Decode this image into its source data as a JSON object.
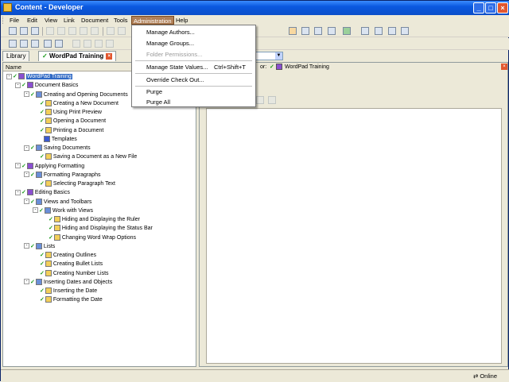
{
  "window": {
    "title": "Content - Developer"
  },
  "menubar": [
    "File",
    "Edit",
    "View",
    "Link",
    "Document",
    "Tools",
    "Administration",
    "Help"
  ],
  "admin_menu": {
    "items": [
      {
        "label": "Manage Authors...",
        "enabled": true,
        "shortcut": ""
      },
      {
        "label": "Manage Groups...",
        "enabled": true,
        "shortcut": ""
      },
      {
        "label": "Folder Permissions...",
        "enabled": false,
        "shortcut": ""
      },
      {
        "label": "Manage State Values...",
        "enabled": true,
        "shortcut": "Ctrl+Shift+T"
      },
      {
        "label": "Override Check Out...",
        "enabled": true,
        "shortcut": ""
      },
      {
        "label": "Purge",
        "enabled": true,
        "shortcut": ""
      },
      {
        "label": "Purge All",
        "enabled": true,
        "shortcut": ""
      }
    ]
  },
  "tabs": {
    "library": "Library",
    "active": "WordPad Training"
  },
  "left_pane": {
    "column_header": "Name"
  },
  "right_pane": {
    "context_label": "or:",
    "context_value": "WordPad Training"
  },
  "tree": [
    {
      "label": "WordPad Training",
      "level": 0,
      "type": "course",
      "expander": "-",
      "checked": true,
      "selected": true
    },
    {
      "label": "Document Basics",
      "level": 1,
      "type": "course",
      "expander": "-",
      "checked": true
    },
    {
      "label": "Creating and Opening Documents",
      "level": 2,
      "type": "module",
      "expander": "-",
      "checked": true
    },
    {
      "label": "Creating a New Document",
      "level": 3,
      "type": "topic",
      "checked": true
    },
    {
      "label": "Using Print Preview",
      "level": 3,
      "type": "topic",
      "checked": true
    },
    {
      "label": "Opening a Document",
      "level": 3,
      "type": "topic",
      "checked": true
    },
    {
      "label": "Printing a Document",
      "level": 3,
      "type": "topic",
      "checked": true
    },
    {
      "label": "Templates",
      "level": 3,
      "type": "doc",
      "checked": false
    },
    {
      "label": "Saving Documents",
      "level": 2,
      "type": "module",
      "expander": "-",
      "checked": true
    },
    {
      "label": "Saving a Document as a New File",
      "level": 3,
      "type": "topic",
      "checked": true
    },
    {
      "label": "Applying Formatting",
      "level": 1,
      "type": "course",
      "expander": "-",
      "checked": true
    },
    {
      "label": "Formatting Paragraphs",
      "level": 2,
      "type": "module",
      "expander": "-",
      "checked": true
    },
    {
      "label": "Selecting Paragraph Text",
      "level": 3,
      "type": "topic",
      "checked": true
    },
    {
      "label": "Editing Basics",
      "level": 1,
      "type": "course",
      "expander": "-",
      "checked": true
    },
    {
      "label": "Views and Toolbars",
      "level": 2,
      "type": "module",
      "expander": "-",
      "checked": true
    },
    {
      "label": "Work with Views",
      "level": 3,
      "type": "module",
      "expander": "-",
      "checked": true
    },
    {
      "label": "Hiding and Displaying the Ruler",
      "level": 4,
      "type": "topic",
      "checked": true
    },
    {
      "label": "Hiding and Displaying the Status Bar",
      "level": 4,
      "type": "topic",
      "checked": true
    },
    {
      "label": "Changing Word Wrap Options",
      "level": 4,
      "type": "topic",
      "checked": true
    },
    {
      "label": "Lists",
      "level": 2,
      "type": "module",
      "expander": "-",
      "checked": true
    },
    {
      "label": "Creating Outlines",
      "level": 3,
      "type": "topic",
      "checked": true
    },
    {
      "label": "Creating Bullet Lists",
      "level": 3,
      "type": "topic",
      "checked": true
    },
    {
      "label": "Creating Number Lists",
      "level": 3,
      "type": "topic",
      "checked": true
    },
    {
      "label": "Inserting Dates and Objects",
      "level": 2,
      "type": "module",
      "expander": "-",
      "checked": true
    },
    {
      "label": "Inserting the Date",
      "level": 3,
      "type": "topic",
      "checked": true
    },
    {
      "label": "Formatting the Date",
      "level": 3,
      "type": "topic",
      "checked": true
    }
  ],
  "statusbar": {
    "status": "Online"
  }
}
